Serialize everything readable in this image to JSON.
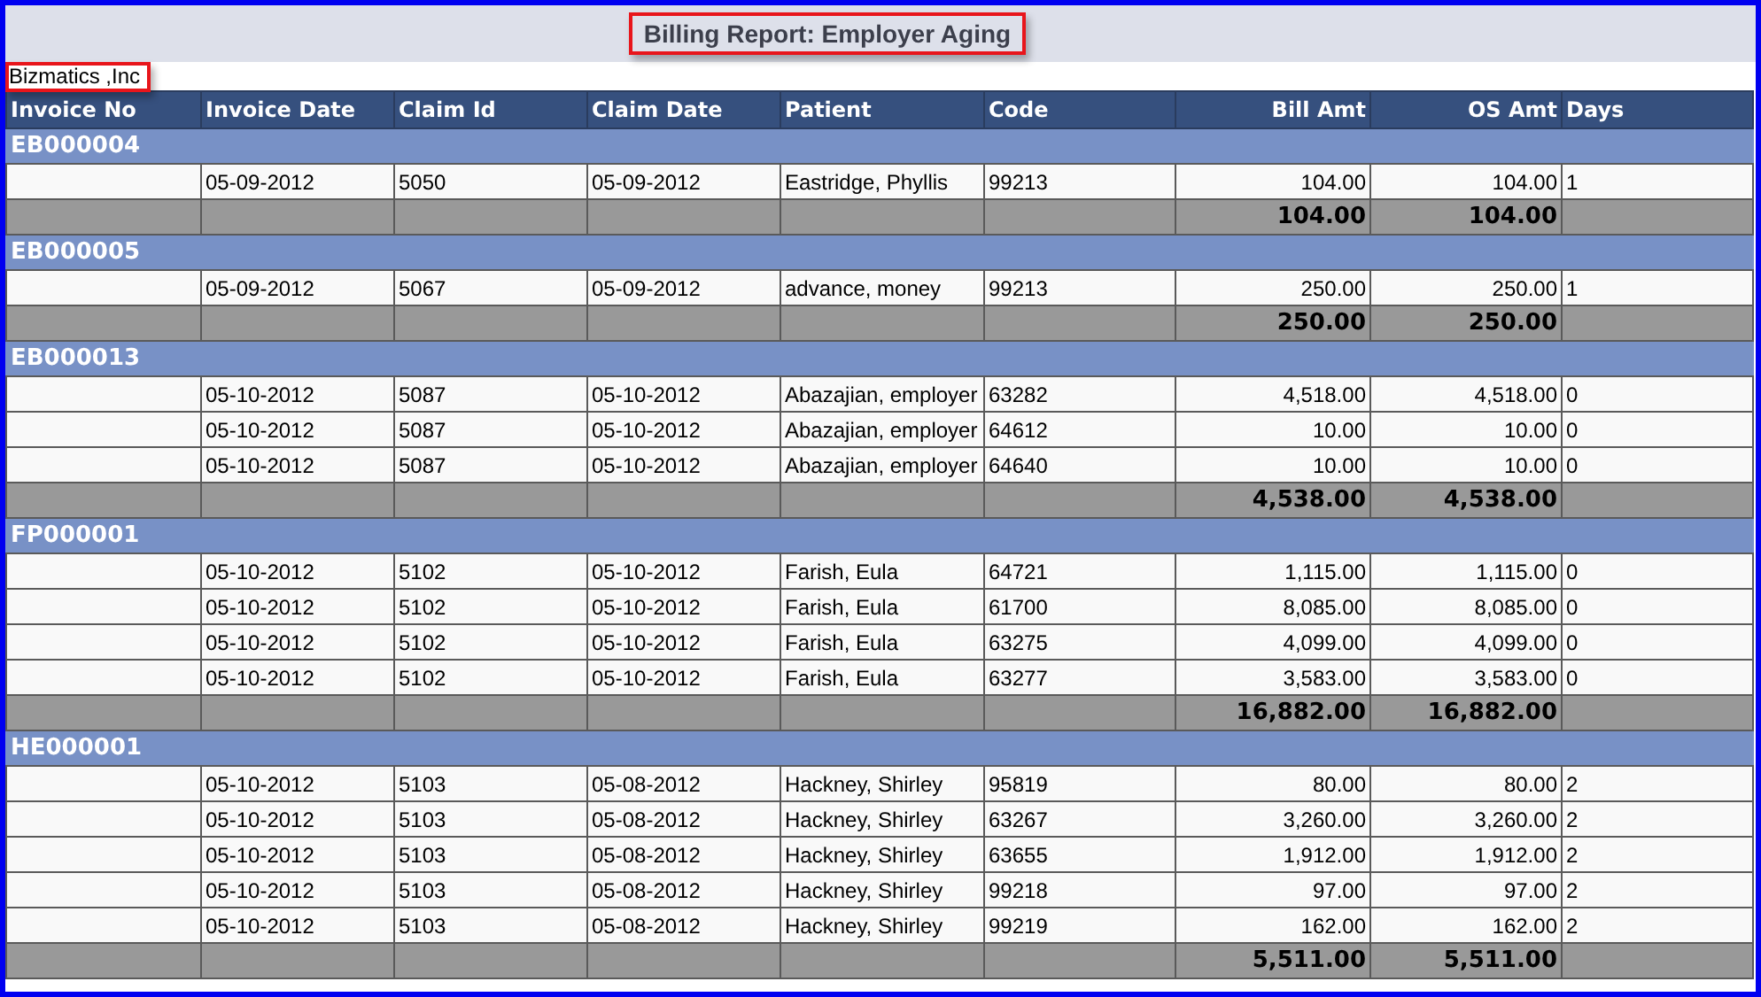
{
  "report_title": "Billing Report: Employer Aging",
  "company": "Bizmatics ,Inc",
  "columns": [
    "Invoice No",
    "Invoice Date",
    "Claim Id",
    "Claim Date",
    "Patient",
    "Code",
    "Bill Amt",
    "OS Amt",
    "Days"
  ],
  "groups": [
    {
      "invoice_no": "EB000004",
      "rows": [
        {
          "invoice_date": "05-09-2012",
          "claim_id": "5050",
          "claim_date": "05-09-2012",
          "patient": "Eastridge, Phyllis",
          "code": "99213",
          "bill_amt": "104.00",
          "os_amt": "104.00",
          "days": "1"
        }
      ],
      "total": {
        "bill_amt": "104.00",
        "os_amt": "104.00"
      }
    },
    {
      "invoice_no": "EB000005",
      "rows": [
        {
          "invoice_date": "05-09-2012",
          "claim_id": "5067",
          "claim_date": "05-09-2012",
          "patient": "advance, money",
          "code": "99213",
          "bill_amt": "250.00",
          "os_amt": "250.00",
          "days": "1"
        }
      ],
      "total": {
        "bill_amt": "250.00",
        "os_amt": "250.00"
      }
    },
    {
      "invoice_no": "EB000013",
      "rows": [
        {
          "invoice_date": "05-10-2012",
          "claim_id": "5087",
          "claim_date": "05-10-2012",
          "patient": "Abazajian, employer",
          "code": "63282",
          "bill_amt": "4,518.00",
          "os_amt": "4,518.00",
          "days": "0"
        },
        {
          "invoice_date": "05-10-2012",
          "claim_id": "5087",
          "claim_date": "05-10-2012",
          "patient": "Abazajian, employer",
          "code": "64612",
          "bill_amt": "10.00",
          "os_amt": "10.00",
          "days": "0"
        },
        {
          "invoice_date": "05-10-2012",
          "claim_id": "5087",
          "claim_date": "05-10-2012",
          "patient": "Abazajian, employer",
          "code": "64640",
          "bill_amt": "10.00",
          "os_amt": "10.00",
          "days": "0"
        }
      ],
      "total": {
        "bill_amt": "4,538.00",
        "os_amt": "4,538.00"
      }
    },
    {
      "invoice_no": "FP000001",
      "rows": [
        {
          "invoice_date": "05-10-2012",
          "claim_id": "5102",
          "claim_date": "05-10-2012",
          "patient": "Farish, Eula",
          "code": "64721",
          "bill_amt": "1,115.00",
          "os_amt": "1,115.00",
          "days": "0"
        },
        {
          "invoice_date": "05-10-2012",
          "claim_id": "5102",
          "claim_date": "05-10-2012",
          "patient": "Farish, Eula",
          "code": "61700",
          "bill_amt": "8,085.00",
          "os_amt": "8,085.00",
          "days": "0"
        },
        {
          "invoice_date": "05-10-2012",
          "claim_id": "5102",
          "claim_date": "05-10-2012",
          "patient": "Farish, Eula",
          "code": "63275",
          "bill_amt": "4,099.00",
          "os_amt": "4,099.00",
          "days": "0"
        },
        {
          "invoice_date": "05-10-2012",
          "claim_id": "5102",
          "claim_date": "05-10-2012",
          "patient": "Farish, Eula",
          "code": "63277",
          "bill_amt": "3,583.00",
          "os_amt": "3,583.00",
          "days": "0"
        }
      ],
      "total": {
        "bill_amt": "16,882.00",
        "os_amt": "16,882.00"
      }
    },
    {
      "invoice_no": "HE000001",
      "rows": [
        {
          "invoice_date": "05-10-2012",
          "claim_id": "5103",
          "claim_date": "05-08-2012",
          "patient": "Hackney, Shirley",
          "code": "95819",
          "bill_amt": "80.00",
          "os_amt": "80.00",
          "days": "2"
        },
        {
          "invoice_date": "05-10-2012",
          "claim_id": "5103",
          "claim_date": "05-08-2012",
          "patient": "Hackney, Shirley",
          "code": "63267",
          "bill_amt": "3,260.00",
          "os_amt": "3,260.00",
          "days": "2"
        },
        {
          "invoice_date": "05-10-2012",
          "claim_id": "5103",
          "claim_date": "05-08-2012",
          "patient": "Hackney, Shirley",
          "code": "63655",
          "bill_amt": "1,912.00",
          "os_amt": "1,912.00",
          "days": "2"
        },
        {
          "invoice_date": "05-10-2012",
          "claim_id": "5103",
          "claim_date": "05-08-2012",
          "patient": "Hackney, Shirley",
          "code": "99218",
          "bill_amt": "97.00",
          "os_amt": "97.00",
          "days": "2"
        },
        {
          "invoice_date": "05-10-2012",
          "claim_id": "5103",
          "claim_date": "05-08-2012",
          "patient": "Hackney, Shirley",
          "code": "99219",
          "bill_amt": "162.00",
          "os_amt": "162.00",
          "days": "2"
        }
      ],
      "total": {
        "bill_amt": "5,511.00",
        "os_amt": "5,511.00"
      }
    }
  ]
}
